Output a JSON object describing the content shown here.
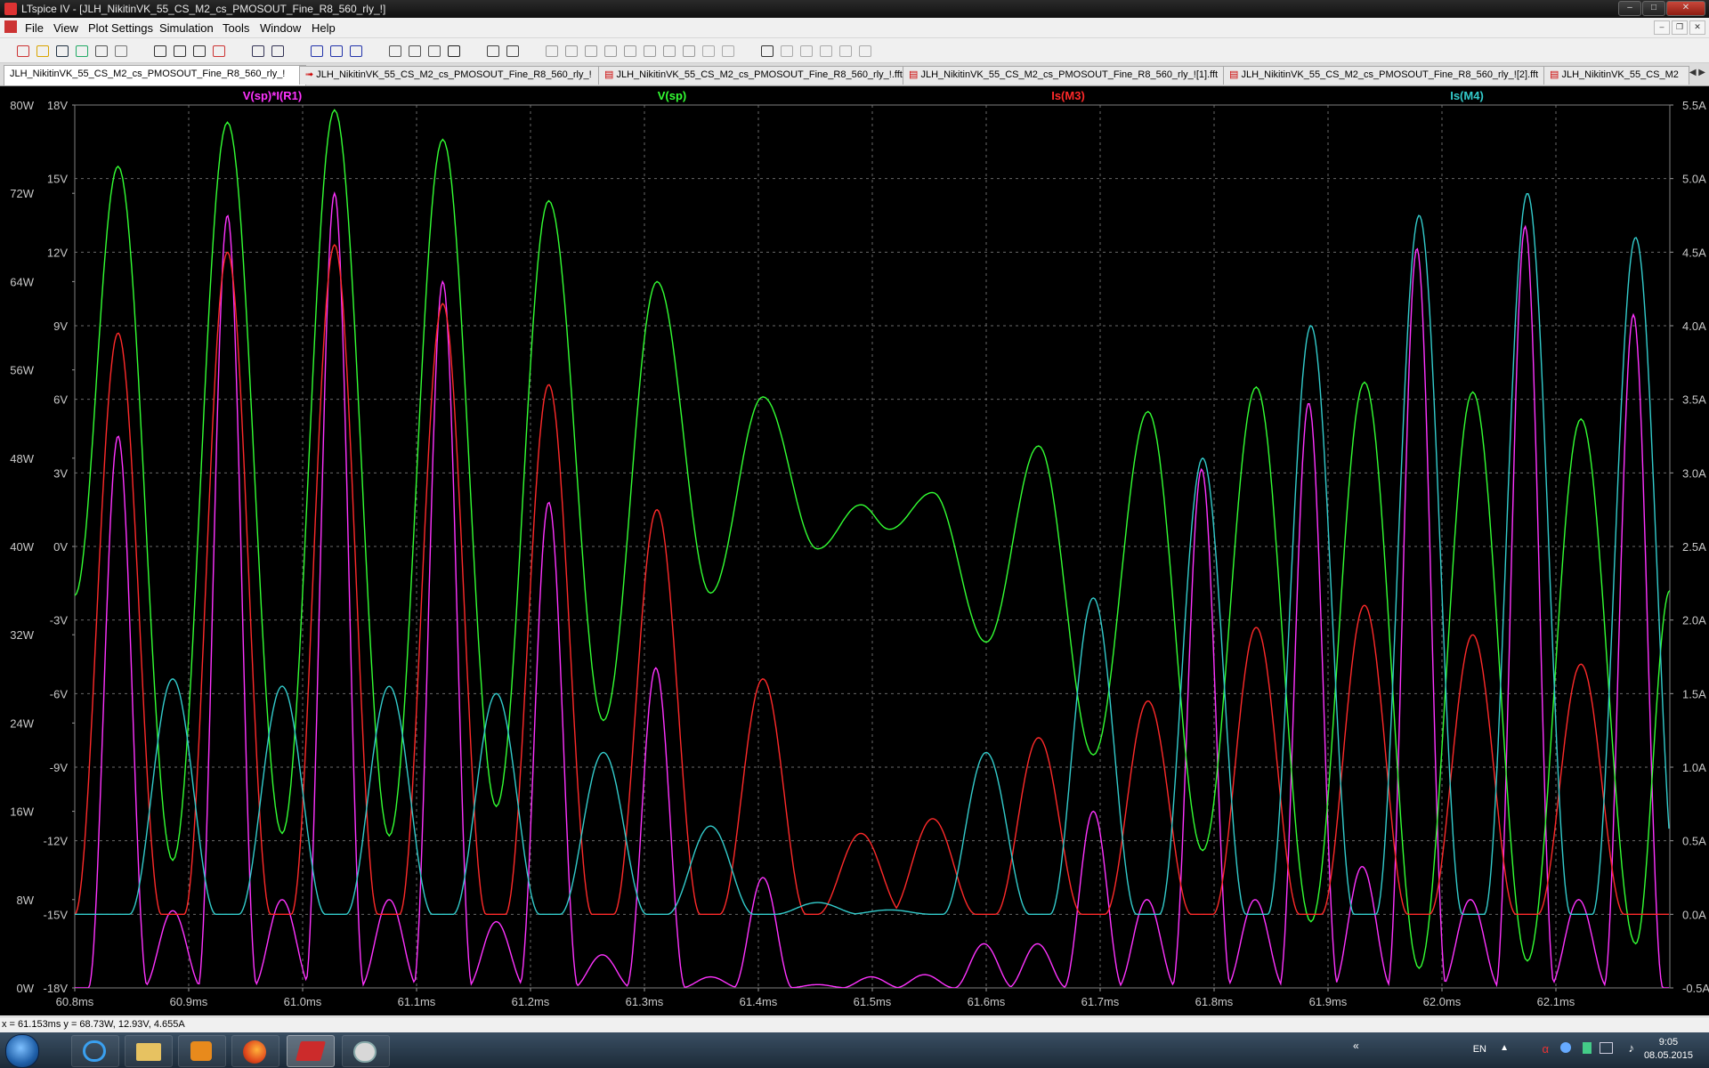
{
  "window": {
    "title": "LTspice IV - [JLH_NikitinVK_55_CS_M2_cs_PMOSOUT_Fine_R8_560_rly_!]"
  },
  "menu": {
    "items": [
      "File",
      "View",
      "Plot Settings",
      "Simulation",
      "Tools",
      "Window",
      "Help"
    ]
  },
  "toolbar": {
    "icons": [
      "new-schematic-icon",
      "open-icon",
      "save-icon",
      "control-panel-icon",
      "run-icon",
      "halt-icon",
      "zoom-in-icon",
      "zoom-out-icon",
      "zoom-fit-icon",
      "zoom-cancel-icon",
      "autorange-icon",
      "fft-icon",
      "tile-horizontal-icon",
      "cascade-icon",
      "tile-vertical-icon",
      "cut-icon",
      "copy-icon",
      "paste-icon",
      "find-icon",
      "print-icon",
      "print-preview-icon",
      "wire-icon",
      "ground-icon",
      "label-icon",
      "resistor-icon",
      "capacitor-icon",
      "inductor-icon",
      "diode-icon",
      "component-icon",
      "move-icon",
      "drag-icon",
      "undo-icon",
      "redo-icon",
      "rotate-icon",
      "mirror-icon",
      "text-icon",
      "spice-directive-icon"
    ]
  },
  "tabs": [
    "JLH_NikitinVK_55_CS_M2_cs_PMOSOUT_Fine_R8_560_rly_!",
    "JLH_NikitinVK_55_CS_M2_cs_PMOSOUT_Fine_R8_560_rly_!",
    "JLH_NikitinVK_55_CS_M2_cs_PMOSOUT_Fine_R8_560_rly_!.fft",
    "JLH_NikitinVK_55_CS_M2_cs_PMOSOUT_Fine_R8_560_rly_![1].fft",
    "JLH_NikitinVK_55_CS_M2_cs_PMOSOUT_Fine_R8_560_rly_![2].fft",
    "JLH_NikitinVK_55_CS_M2"
  ],
  "chart_data": {
    "type": "line",
    "x_ticks": [
      "60.8ms",
      "60.9ms",
      "61.0ms",
      "61.1ms",
      "61.2ms",
      "61.3ms",
      "61.4ms",
      "61.5ms",
      "61.6ms",
      "61.7ms",
      "61.8ms",
      "61.9ms",
      "62.0ms",
      "62.1ms"
    ],
    "xlim": [
      60.8,
      62.2
    ],
    "x_unit": "ms",
    "axes": {
      "power": {
        "ticks": [
          "80W",
          "72W",
          "64W",
          "56W",
          "48W",
          "40W",
          "32W",
          "24W",
          "16W",
          "8W",
          "0W"
        ],
        "range": [
          0,
          80
        ]
      },
      "voltage": {
        "ticks": [
          "18V",
          "15V",
          "12V",
          "9V",
          "6V",
          "3V",
          "0V",
          "-3V",
          "-6V",
          "-9V",
          "-12V",
          "-15V",
          "-18V"
        ],
        "range": [
          -18,
          18
        ]
      },
      "current": {
        "ticks": [
          "5.5A",
          "5.0A",
          "4.5A",
          "4.0A",
          "3.5A",
          "3.0A",
          "2.5A",
          "2.0A",
          "1.5A",
          "1.0A",
          "0.5A",
          "0.0A",
          "-0.5A"
        ],
        "range": [
          -0.5,
          5.5
        ]
      }
    },
    "grid": true,
    "series": [
      {
        "name": "V(sp)*I(R1)",
        "axis": "power",
        "color": "#ff33ff",
        "peaks_x": [
          60.838,
          60.886,
          60.934,
          60.982,
          61.028,
          61.076,
          61.123,
          61.17,
          61.216,
          61.263,
          61.31,
          61.358,
          61.404,
          61.452,
          61.499,
          61.546,
          61.598,
          61.645,
          61.694,
          61.741,
          61.789,
          61.836,
          61.883,
          61.93,
          61.978,
          62.025,
          62.073,
          62.12,
          62.168
        ],
        "peaks_y": [
          50,
          7,
          70,
          8,
          72,
          8,
          64,
          6,
          44,
          3,
          29,
          1,
          10,
          0.3,
          1,
          1.2,
          4,
          4,
          16,
          8,
          47,
          8,
          53,
          11,
          67,
          8,
          69,
          8,
          61
        ]
      },
      {
        "name": "V(sp)",
        "axis": "voltage",
        "color": "#33ff33",
        "extrema_x": [
          60.8,
          60.838,
          60.886,
          60.934,
          60.982,
          61.028,
          61.076,
          61.123,
          61.17,
          61.216,
          61.264,
          61.311,
          61.358,
          61.404,
          61.452,
          61.49,
          61.515,
          61.553,
          61.6,
          61.646,
          61.694,
          61.742,
          61.79,
          61.837,
          61.885,
          61.932,
          61.98,
          62.027,
          62.075,
          62.122,
          62.17,
          62.2
        ],
        "extrema_y": [
          -2,
          15.5,
          -12.8,
          17.3,
          -11.7,
          17.8,
          -11.8,
          16.6,
          -10.6,
          14.1,
          -7.1,
          10.8,
          -1.9,
          6.1,
          -0.1,
          1.7,
          0.7,
          2.2,
          -3.9,
          4.1,
          -8.5,
          5.5,
          -12.4,
          6.5,
          -15.3,
          6.7,
          -17.2,
          6.3,
          -16.9,
          5.2,
          -16.2,
          -1.8
        ]
      },
      {
        "name": "Is(M3)",
        "axis": "current",
        "color": "#ff2a2a",
        "peaks_x": [
          60.838,
          60.934,
          61.028,
          61.123,
          61.216,
          61.311,
          61.404,
          61.49,
          61.553,
          61.646,
          61.742,
          61.837,
          61.932,
          62.027,
          62.122
        ],
        "peaks_y": [
          3.95,
          4.5,
          4.55,
          4.15,
          3.6,
          2.75,
          1.6,
          0.55,
          0.65,
          1.2,
          1.45,
          1.95,
          2.1,
          1.9,
          1.7
        ]
      },
      {
        "name": "Is(M4)",
        "axis": "current",
        "color": "#33cccc",
        "peaks_x": [
          60.886,
          60.982,
          61.076,
          61.17,
          61.264,
          61.358,
          61.452,
          61.515,
          61.6,
          61.694,
          61.79,
          61.885,
          61.98,
          62.075,
          62.17
        ],
        "peaks_y": [
          1.6,
          1.55,
          1.55,
          1.5,
          1.1,
          0.6,
          0.08,
          0.03,
          1.1,
          2.15,
          3.1,
          4.0,
          4.75,
          4.9,
          4.6
        ]
      }
    ]
  },
  "status": {
    "readout": "x = 61.153ms    y = 68.73W, 12.93V, 4.655A"
  },
  "taskbar": {
    "apps": [
      "internet-explorer-icon",
      "file-explorer-icon",
      "media-player-icon",
      "firefox-icon",
      "ltspice-icon",
      "paint-icon"
    ],
    "language": "EN",
    "time": "9:05",
    "date": "08.05.2015"
  }
}
